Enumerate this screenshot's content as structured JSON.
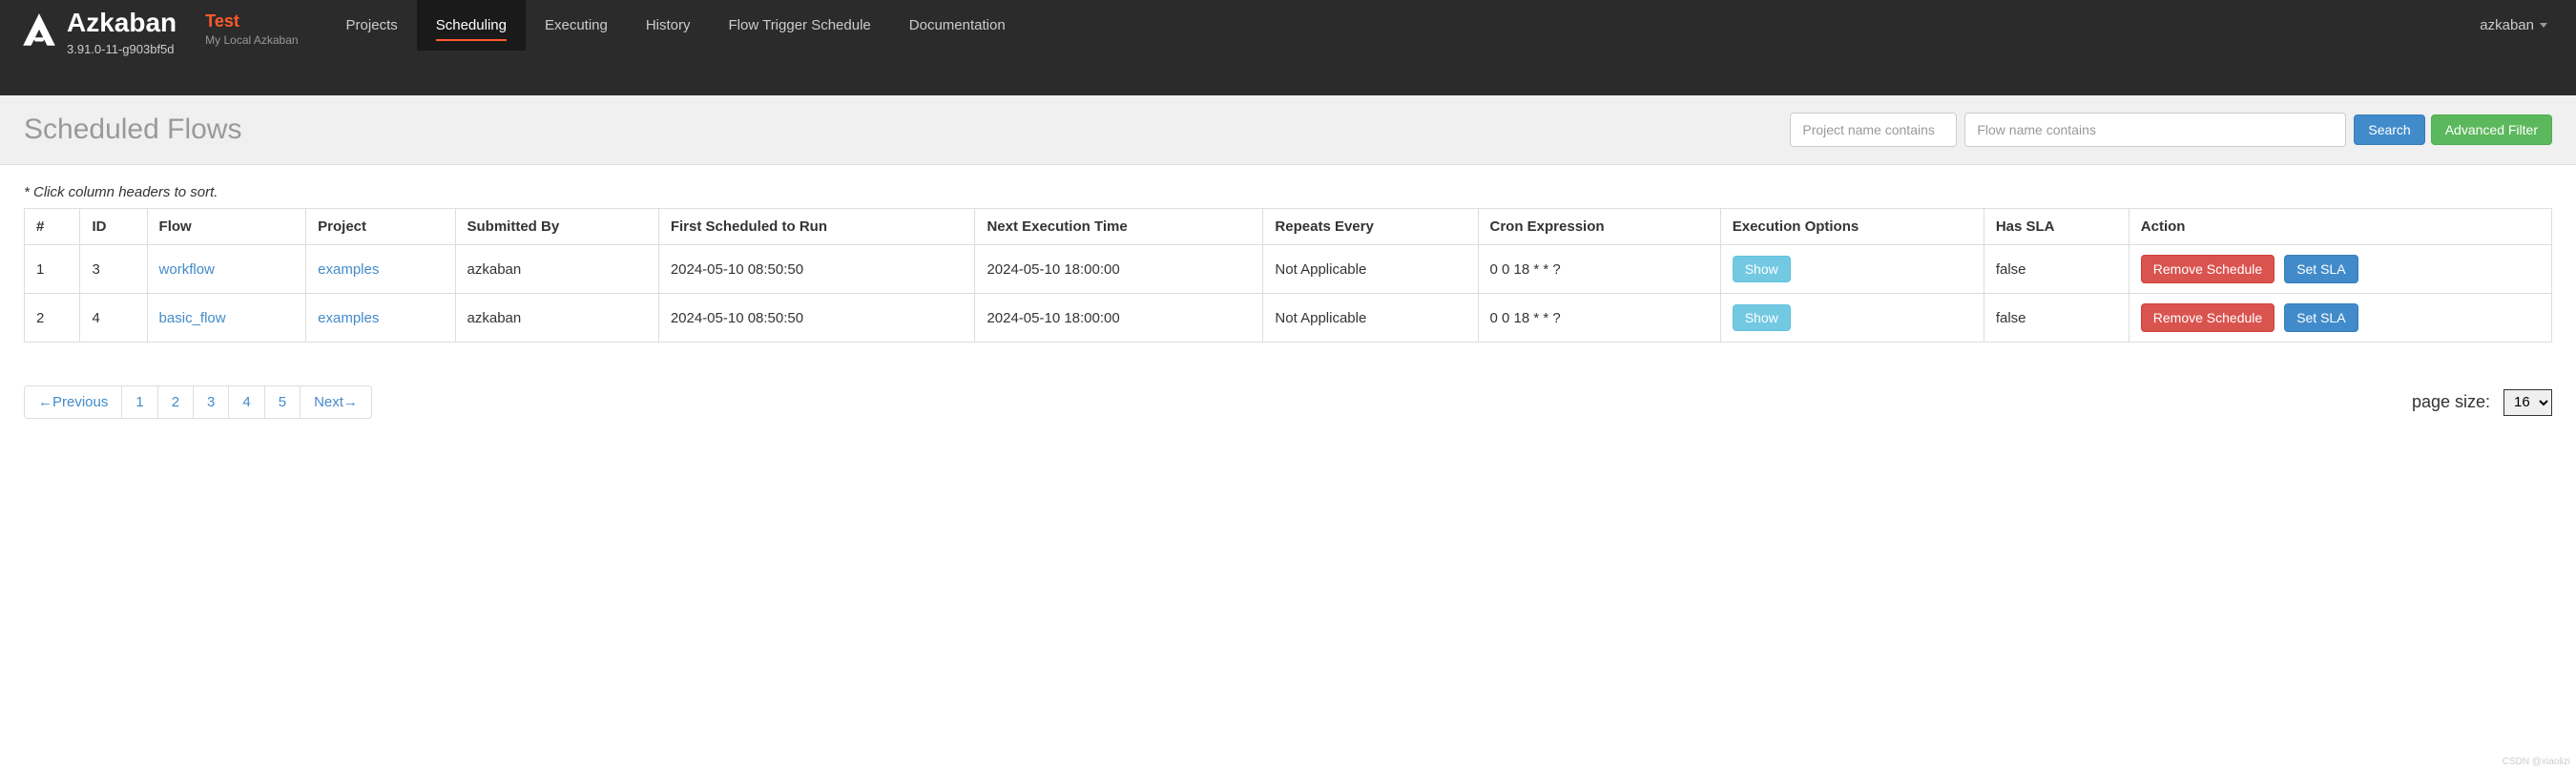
{
  "brand": {
    "name": "Azkaban",
    "version": "3.91.0-11-g903bf5d"
  },
  "label": {
    "name": "Test",
    "sub": "My Local Azkaban"
  },
  "nav": {
    "items": [
      "Projects",
      "Scheduling",
      "Executing",
      "History",
      "Flow Trigger Schedule",
      "Documentation"
    ],
    "active_index": 1
  },
  "user": {
    "name": "azkaban"
  },
  "page": {
    "title": "Scheduled Flows",
    "project_filter_placeholder": "Project name contains",
    "flow_filter_placeholder": "Flow name contains",
    "search_label": "Search",
    "advanced_filter_label": "Advanced Filter",
    "hint": "* Click column headers to sort."
  },
  "table": {
    "headers": [
      "#",
      "ID",
      "Flow",
      "Project",
      "Submitted By",
      "First Scheduled to Run",
      "Next Execution Time",
      "Repeats Every",
      "Cron Expression",
      "Execution Options",
      "Has SLA",
      "Action"
    ],
    "show_label": "Show",
    "remove_label": "Remove Schedule",
    "sla_label": "Set SLA",
    "rows": [
      {
        "num": "1",
        "id": "3",
        "flow": "workflow",
        "project": "examples",
        "submitted_by": "azkaban",
        "first": "2024-05-10 08:50:50",
        "next": "2024-05-10 18:00:00",
        "repeats": "Not Applicable",
        "cron": "0 0 18 * * ?",
        "has_sla": "false"
      },
      {
        "num": "2",
        "id": "4",
        "flow": "basic_flow",
        "project": "examples",
        "submitted_by": "azkaban",
        "first": "2024-05-10 08:50:50",
        "next": "2024-05-10 18:00:00",
        "repeats": "Not Applicable",
        "cron": "0 0 18 * * ?",
        "has_sla": "false"
      }
    ]
  },
  "pagination": {
    "prev": "←Previous",
    "pages": [
      "1",
      "2",
      "3",
      "4",
      "5"
    ],
    "next": "Next→",
    "page_size_label": "page size:",
    "page_size_value": "16"
  },
  "watermark": "CSDN @xiaolizi"
}
